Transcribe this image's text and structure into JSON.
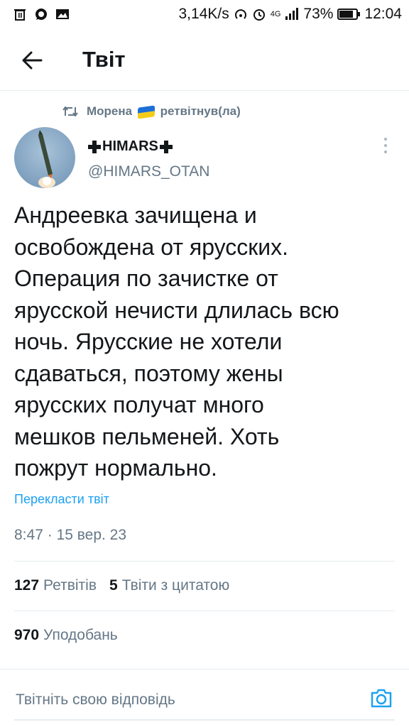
{
  "status_bar": {
    "net_speed": "3,14K/s",
    "net_type": "4G",
    "battery": "73%",
    "time": "12:04",
    "left_icons": [
      "trash-icon",
      "whatsapp-icon",
      "image-icon"
    ],
    "right_icons": [
      "hotspot-icon",
      "alarm-icon",
      "signal-icon",
      "battery-icon"
    ]
  },
  "header": {
    "title": "Твіт",
    "back_icon": "arrow-left-icon"
  },
  "retweet": {
    "user": "Морена",
    "flag": "ukraine-flag",
    "action": "ретвітнув(ла)"
  },
  "author": {
    "name": "HIMARS",
    "handle": "@HIMARS_OTAN"
  },
  "tweet": {
    "lines": [
      "Андреевка зачищена и",
      "освобождена от ярусских.",
      "Операция по зачистке от",
      "ярусской нечисти длилась всю",
      "ночь. Ярусские не хотели",
      "сдаваться, поэтому жены",
      "ярусских получат много",
      "мешков пельменей. Хоть",
      "пожрут нормально."
    ],
    "translate_label": "Перекласти твіт",
    "timestamp": "8:47 · 15 вер. 23"
  },
  "stats": {
    "retweets_count": "127",
    "retweets_label": "Ретвітів",
    "quotes_count": "5",
    "quotes_label": "Твіти з цитатою",
    "likes_count": "970",
    "likes_label": "Уподобань"
  },
  "reply": {
    "placeholder": "Твітніть свою відповідь",
    "camera_icon": "camera-icon"
  },
  "colors": {
    "accent": "#1da1f2",
    "secondary_text": "#657786",
    "divider": "#e6ecf0"
  }
}
